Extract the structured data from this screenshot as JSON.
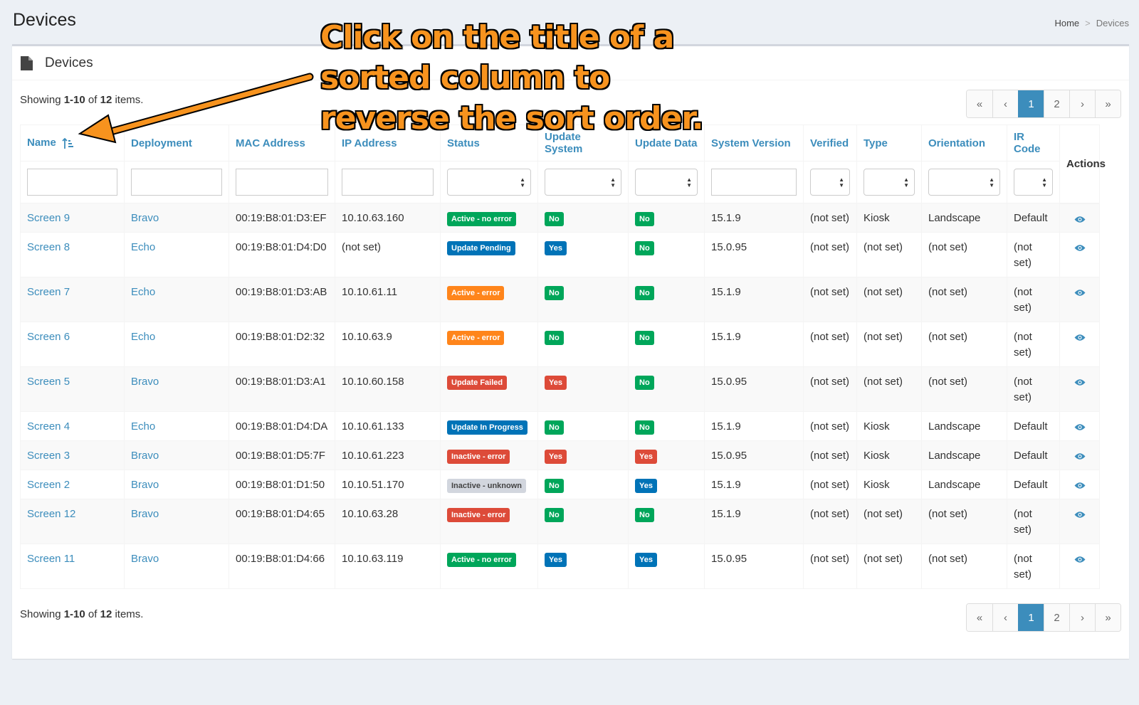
{
  "page": {
    "title": "Devices"
  },
  "breadcrumb": {
    "home": "Home",
    "separator": ">",
    "current": "Devices"
  },
  "box": {
    "title": "Devices"
  },
  "summary": {
    "prefix": "Showing ",
    "range": "1-10",
    "middle": " of ",
    "total": "12",
    "suffix": " items."
  },
  "pagination": {
    "first": "«",
    "prev": "‹",
    "pages": [
      "1",
      "2"
    ],
    "active": "1",
    "next": "›",
    "last": "»"
  },
  "annotation": {
    "lines": [
      "Click on the title of a",
      "sorted column to",
      "reverse the sort order."
    ]
  },
  "columns": [
    "Name",
    "Deployment",
    "MAC Address",
    "IP Address",
    "Status",
    "Update System",
    "Update Data",
    "System Version",
    "Verified",
    "Type",
    "Orientation",
    "IR Code",
    "Actions"
  ],
  "rows": [
    {
      "name": "Screen 9",
      "deployment": "Bravo",
      "mac": "00:19:B8:01:D3:EF",
      "ip": "10.10.63.160",
      "status": "Active - no error",
      "status_color": "green",
      "update_system": "No",
      "us_color": "green",
      "update_data": "No",
      "ud_color": "green",
      "version": "15.1.9",
      "verified": "(not set)",
      "type": "Kiosk",
      "orientation": "Landscape",
      "ir_code": "Default",
      "tall": false
    },
    {
      "name": "Screen 8",
      "deployment": "Echo",
      "mac": "00:19:B8:01:D4:D0",
      "ip": "(not set)",
      "status": "Update Pending",
      "status_color": "blue",
      "update_system": "Yes",
      "us_color": "blue",
      "update_data": "No",
      "ud_color": "green",
      "version": "15.0.95",
      "verified": "(not set)",
      "type": "(not set)",
      "orientation": "(not set)",
      "ir_code": "(not set)",
      "tall": true
    },
    {
      "name": "Screen 7",
      "deployment": "Echo",
      "mac": "00:19:B8:01:D3:AB",
      "ip": "10.10.61.11",
      "status": "Active - error",
      "status_color": "orange",
      "update_system": "No",
      "us_color": "green",
      "update_data": "No",
      "ud_color": "green",
      "version": "15.1.9",
      "verified": "(not set)",
      "type": "(not set)",
      "orientation": "(not set)",
      "ir_code": "(not set)",
      "tall": true
    },
    {
      "name": "Screen 6",
      "deployment": "Echo",
      "mac": "00:19:B8:01:D2:32",
      "ip": "10.10.63.9",
      "status": "Active - error",
      "status_color": "orange",
      "update_system": "No",
      "us_color": "green",
      "update_data": "No",
      "ud_color": "green",
      "version": "15.1.9",
      "verified": "(not set)",
      "type": "(not set)",
      "orientation": "(not set)",
      "ir_code": "(not set)",
      "tall": true
    },
    {
      "name": "Screen 5",
      "deployment": "Bravo",
      "mac": "00:19:B8:01:D3:A1",
      "ip": "10.10.60.158",
      "status": "Update Failed",
      "status_color": "red",
      "update_system": "Yes",
      "us_color": "red",
      "update_data": "No",
      "ud_color": "green",
      "version": "15.0.95",
      "verified": "(not set)",
      "type": "(not set)",
      "orientation": "(not set)",
      "ir_code": "(not set)",
      "tall": true
    },
    {
      "name": "Screen 4",
      "deployment": "Echo",
      "mac": "00:19:B8:01:D4:DA",
      "ip": "10.10.61.133",
      "status": "Update In Progress",
      "status_color": "blue",
      "update_system": "No",
      "us_color": "green",
      "update_data": "No",
      "ud_color": "green",
      "version": "15.1.9",
      "verified": "(not set)",
      "type": "Kiosk",
      "orientation": "Landscape",
      "ir_code": "Default",
      "tall": false
    },
    {
      "name": "Screen 3",
      "deployment": "Bravo",
      "mac": "00:19:B8:01:D5:7F",
      "ip": "10.10.61.223",
      "status": "Inactive - error",
      "status_color": "red",
      "update_system": "Yes",
      "us_color": "red",
      "update_data": "Yes",
      "ud_color": "red",
      "version": "15.0.95",
      "verified": "(not set)",
      "type": "Kiosk",
      "orientation": "Landscape",
      "ir_code": "Default",
      "tall": false
    },
    {
      "name": "Screen 2",
      "deployment": "Bravo",
      "mac": "00:19:B8:01:D1:50",
      "ip": "10.10.51.170",
      "status": "Inactive - unknown",
      "status_color": "gray",
      "update_system": "No",
      "us_color": "green",
      "update_data": "Yes",
      "ud_color": "blue",
      "version": "15.1.9",
      "verified": "(not set)",
      "type": "Kiosk",
      "orientation": "Landscape",
      "ir_code": "Default",
      "tall": false
    },
    {
      "name": "Screen 12",
      "deployment": "Bravo",
      "mac": "00:19:B8:01:D4:65",
      "ip": "10.10.63.28",
      "status": "Inactive - error",
      "status_color": "red",
      "update_system": "No",
      "us_color": "green",
      "update_data": "No",
      "ud_color": "green",
      "version": "15.1.9",
      "verified": "(not set)",
      "type": "(not set)",
      "orientation": "(not set)",
      "ir_code": "(not set)",
      "tall": true
    },
    {
      "name": "Screen 11",
      "deployment": "Bravo",
      "mac": "00:19:B8:01:D4:66",
      "ip": "10.10.63.119",
      "status": "Active - no error",
      "status_color": "green",
      "update_system": "Yes",
      "us_color": "blue",
      "update_data": "Yes",
      "ud_color": "blue",
      "version": "15.0.95",
      "verified": "(not set)",
      "type": "(not set)",
      "orientation": "(not set)",
      "ir_code": "(not set)",
      "tall": true
    }
  ],
  "icons": {
    "view": "eye-icon",
    "sort": "sort-ascending-icon",
    "document": "document-icon"
  },
  "colors": {
    "accent": "#3c8dbc",
    "annotation": "#f7931e"
  }
}
